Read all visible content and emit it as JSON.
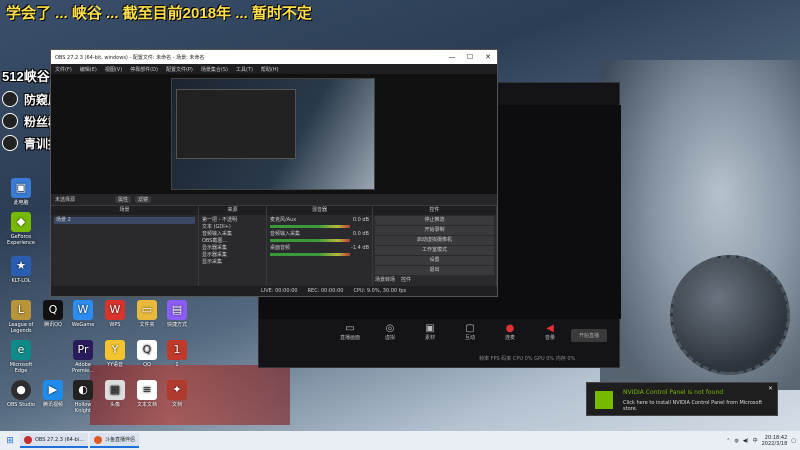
{
  "overlay": {
    "top_text": "学会了 ... 峡谷 ... 截至目前2018年 ... 暂时不定",
    "title": "512峡谷第一国服第一振克",
    "lines": [
      "防窥屏延迟45秒",
      "粉丝群336828284",
      "青训招1378038730"
    ]
  },
  "desktop_icons": {
    "row1": [
      "Microsoft Edge",
      "Adobe Premie...",
      "YY语音",
      "QQ",
      "1"
    ],
    "row2": [
      "OBS Studio",
      "腾讯视频",
      "Hollow Knight",
      "头像",
      "文本文档",
      "文档"
    ],
    "row3": [
      "League of Legends",
      "腾讯QQ",
      "WeGame",
      "WPS",
      "文件夹",
      "快捷方式"
    ],
    "left_col": [
      "此电脑",
      "GeForce Experience",
      "KLT-LOL",
      "回收站"
    ]
  },
  "obs": {
    "title": "OBS 27.2.3 (64-bit, windows) - 配置文件: 未命名 - 场景: 未命名",
    "menu": [
      "文件(F)",
      "编辑(E)",
      "视图(V)",
      "停靠部件(D)",
      "配置文件(P)",
      "场景集合(S)",
      "工具(T)",
      "帮助(H)"
    ],
    "source_bar_label": "未选择源",
    "source_bar_buttons": [
      "属性",
      "滤镜"
    ],
    "docks": {
      "scenes": {
        "header": "场景",
        "items": [
          "场景 2"
        ]
      },
      "sources": {
        "header": "来源",
        "items": [
          "第一把 - 不透明",
          "文本 (GDI+)",
          "音频输入采集",
          "OBS截图...",
          "显示器采集",
          "显示器采集",
          "显示采集"
        ]
      },
      "mixer": {
        "header": "混音器",
        "channels": [
          {
            "name": "麦克风/Aux",
            "value": "0.0 dB"
          },
          {
            "name": "音频输入采集",
            "value": "0.0 dB"
          },
          {
            "name": "桌面音频",
            "value": "-1.4 dB"
          }
        ]
      },
      "controls": {
        "header": "控件",
        "buttons": [
          "停止推流",
          "开始录制",
          "启动虚拟摄像机",
          "工作室模式",
          "设置",
          "退出"
        ],
        "tabs": [
          "场景转场",
          "控件"
        ]
      }
    },
    "status": [
      "LIVE: 00:00:00",
      "REC: 00:00:00",
      "CPU: 9.0%, 30.00 fps"
    ]
  },
  "panel": {
    "tools": [
      "直播画面",
      "虚拟",
      "素材",
      "互动",
      "连麦",
      "音量"
    ],
    "start_label": "开始直播",
    "stats_text": "帧率 FPS 码率 CPU 0% GPU 0% 内存 0%"
  },
  "notification": {
    "title": "NVIDIA Control Panel is not found",
    "body": "Click here to install NVIDIA Control Panel from Microsoft store.",
    "close": "✕"
  },
  "taskbar": {
    "tasks": [
      {
        "label": "OBS 27.2.3 (64-bi...",
        "color": "#c53030"
      },
      {
        "label": "斗鱼直播伴侣",
        "color": "#e25822"
      }
    ],
    "time": "20:18:42",
    "date": "2022/3/18",
    "lang": "中"
  }
}
